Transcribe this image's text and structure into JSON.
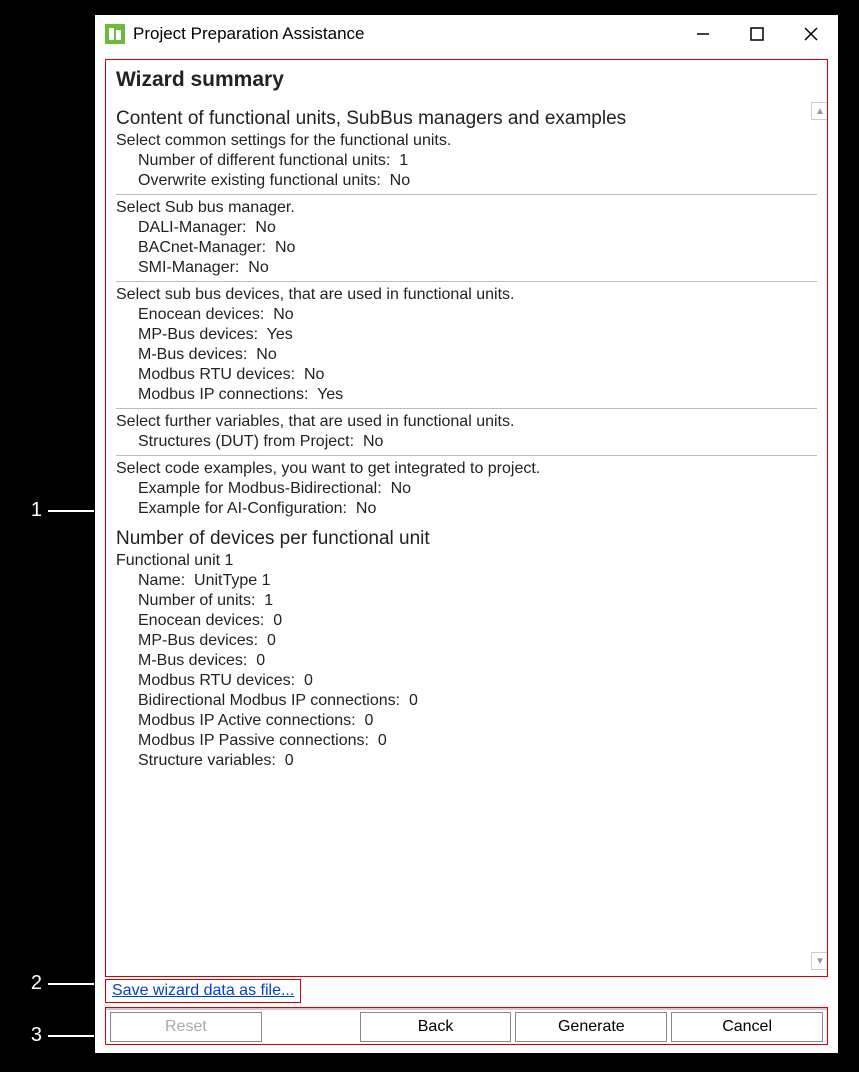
{
  "callouts": {
    "c1": "1",
    "c2": "2",
    "c3": "3"
  },
  "titlebar": {
    "title": "Project Preparation Assistance"
  },
  "summary": {
    "title": "Wizard summary",
    "section1": {
      "heading": "Content of functional units, SubBus managers and examples",
      "settings_label": "Select common settings for the functional units.",
      "num_units": {
        "k": "Number of different functional units",
        "v": "1"
      },
      "overwrite": {
        "k": "Overwrite existing functional units",
        "v": "No"
      },
      "bus_mgr_label": "Select Sub bus manager.",
      "dali": {
        "k": "DALI-Manager",
        "v": "No"
      },
      "bacnet": {
        "k": "BACnet-Manager",
        "v": "No"
      },
      "smi": {
        "k": "SMI-Manager",
        "v": "No"
      },
      "bus_dev_label": "Select sub bus devices, that are used in functional units.",
      "enocean": {
        "k": "Enocean devices",
        "v": "No"
      },
      "mpbus": {
        "k": "MP-Bus devices",
        "v": "Yes"
      },
      "mbus": {
        "k": "M-Bus devices",
        "v": "No"
      },
      "modbusrtu": {
        "k": "Modbus RTU devices",
        "v": "No"
      },
      "modbusip": {
        "k": "Modbus IP connections",
        "v": "Yes"
      },
      "vars_label": "Select further variables, that are used in functional units.",
      "dut": {
        "k": "Structures (DUT) from Project",
        "v": "No"
      },
      "examples_label": "Select code examples, you want to get integrated to project.",
      "ex_bidi": {
        "k": "Example for Modbus-Bidirectional",
        "v": "No"
      },
      "ex_ai": {
        "k": "Example for AI-Configuration",
        "v": "No"
      }
    },
    "section2": {
      "heading": "Number of devices per functional unit",
      "unit_label": "Functional unit 1",
      "name": {
        "k": "Name",
        "v": "UnitType 1"
      },
      "num": {
        "k": "Number of units",
        "v": "1"
      },
      "enocean": {
        "k": "Enocean devices",
        "v": "0"
      },
      "mpbus": {
        "k": "MP-Bus devices",
        "v": "0"
      },
      "mbus": {
        "k": "M-Bus devices",
        "v": "0"
      },
      "modbusrtu": {
        "k": "Modbus RTU devices",
        "v": "0"
      },
      "bidi": {
        "k": "Bidirectional Modbus IP connections",
        "v": "0"
      },
      "active": {
        "k": "Modbus IP Active connections",
        "v": "0"
      },
      "passive": {
        "k": "Modbus IP Passive connections",
        "v": "0"
      },
      "struct": {
        "k": "Structure variables",
        "v": "0"
      }
    }
  },
  "save_link": "Save wizard data as file...",
  "buttons": {
    "reset": "Reset",
    "back": "Back",
    "generate": "Generate",
    "cancel": "Cancel"
  }
}
